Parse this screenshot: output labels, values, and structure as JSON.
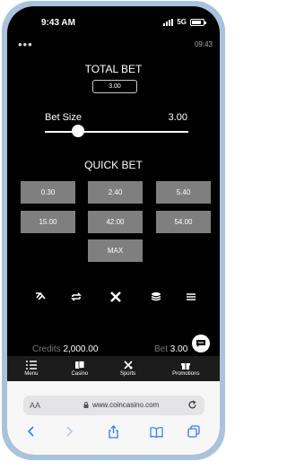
{
  "status": {
    "time": "9:43 AM",
    "network": "5G"
  },
  "topbar": {
    "clock": "09:43"
  },
  "total_bet": {
    "label": "TOTAL BET",
    "value": "3.00"
  },
  "bet_size": {
    "label": "Bet Size",
    "value": "3.00",
    "level_fraction": 0.23
  },
  "quick_bet": {
    "label": "QUICK BET",
    "options": [
      "0.30",
      "2.40",
      "5.40",
      "15.00",
      "42.00",
      "54.00",
      "MAX"
    ]
  },
  "toolbar": {
    "icons": [
      "autoplay-icon",
      "refresh-icon",
      "close-icon",
      "coins-icon",
      "menu-icon"
    ]
  },
  "footer": {
    "credits_label": "Credits",
    "credits_value": "2,000.00",
    "bet_label": "Bet",
    "bet_value": "3.00"
  },
  "nav": {
    "items": [
      {
        "label": "Menu",
        "icon": "list-icon"
      },
      {
        "label": "Casino",
        "icon": "cards-icon"
      },
      {
        "label": "Sports",
        "icon": "sports-icon"
      },
      {
        "label": "Promotions",
        "icon": "gift-icon"
      }
    ]
  },
  "browser": {
    "aa": "AA",
    "url": "www.coincasino.com"
  },
  "colors": {
    "background": "#000000",
    "button": "#7f7f7f",
    "phone_frame": "#a9c3dc"
  }
}
